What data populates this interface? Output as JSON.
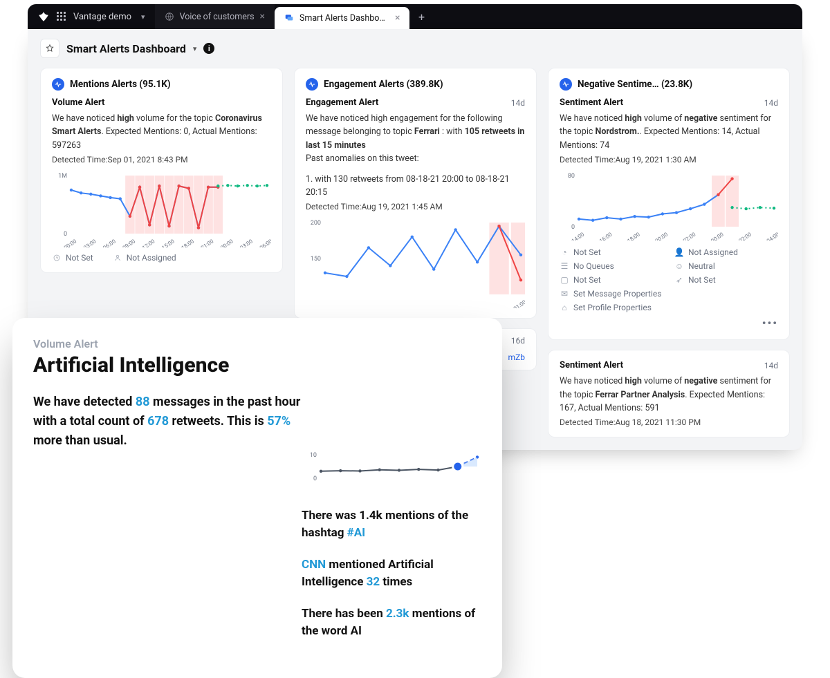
{
  "topbar": {
    "workspace": "Vantage demo",
    "tabs": [
      {
        "label": "Voice of customers",
        "active": false
      },
      {
        "label": "Smart Alerts Dashboard",
        "active": true
      }
    ]
  },
  "page": {
    "title": "Smart Alerts Dashboard"
  },
  "columns": {
    "mentions": {
      "header": "Mentions Alerts  (95.1K)",
      "alert": {
        "title": "Volume Alert",
        "text_pre": "We have noticed ",
        "text_bold1": "high",
        "text_mid": " volume for the topic ",
        "text_bold2": "Coronavirus Smart Alerts",
        "text_post": ". Expected Mentions: 0, Actual Mentions: 597263",
        "detected": "Detected Time:Sep 01, 2021 8:43 PM"
      },
      "meta": {
        "notset": "Not Set",
        "notassigned": "Not Assigned"
      }
    },
    "engagement": {
      "header": "Engagement Alerts  (389.8K)",
      "alert": {
        "title": "Engagement Alert",
        "age": "14d",
        "line1": "We have noticed high engagement for the following message belonging to topic ",
        "bold1": "Ferrari",
        "line2": " :  with ",
        "bold2": "105 retweets in last 15 minutes",
        "line3": "Past anomalies on this tweet:",
        "line4": "1.  with 130 retweets from 08-18-21 20:00 to 08-18-21 20:15",
        "detected": "Detected Time:Aug 19, 2021 1:45 AM"
      },
      "second": {
        "age": "16d",
        "link": "mZb"
      }
    },
    "sentiment": {
      "header": "Negative Sentime…   (23.8K)",
      "alert": {
        "title": "Sentiment Alert",
        "age": "14d",
        "pre": "We have noticed ",
        "b1": "high",
        "mid1": " volume of ",
        "b2": "negative",
        "mid2": " sentiment for the topic ",
        "b3": "Nordstrom.",
        "post": ". Expected Mentions: 14, Actual Mentions: 74",
        "detected": "Detected Time:Aug 19, 2021 1:30 AM"
      },
      "meta": {
        "notset": "Not Set",
        "notassigned": "Not Assigned",
        "noqueues": "No Queues",
        "neutral": "Neutral",
        "notset2": "Not Set",
        "notset3": "Not Set",
        "setmsg": "Set Message Properties",
        "setprof": "Set Profile Properties"
      },
      "alert2": {
        "title": "Sentiment Alert",
        "age": "14d",
        "pre": "We have noticed ",
        "b1": "high",
        "mid1": " volume of ",
        "b2": "negative",
        "mid2": " sentiment for the topic ",
        "b3": "Ferrar Partner Analysis",
        "post": ". Expected Mentions: 167, Actual Mentions: 591",
        "detected": "Detected Time:Aug 18, 2021 11:30 PM"
      }
    }
  },
  "overlay": {
    "kicker": "Volume Alert",
    "title": "Artificial Intelligence",
    "body": {
      "p1": "We have detected ",
      "n1": "88",
      "p2": " messages in the past hour with a total count of ",
      "n2": "678",
      "p3": " retweets. This is ",
      "n3": "57%",
      "p4": " more than usual."
    },
    "right": {
      "l1a": "There was 1.4k mentions of the hashtag ",
      "l1tag": "#AI",
      "l2a": "CNN",
      "l2b": " mentioned Artificial Intelligence ",
      "l2n": "32",
      "l2c": " times",
      "l3a": "There has been ",
      "l3n": "2.3k",
      "l3b": " mentions of the word AI"
    }
  },
  "chart_data": [
    {
      "id": "mentions-chart",
      "type": "line",
      "title": "",
      "xlabel": "",
      "ylabel": "",
      "categories": [
        "00:00",
        "03:00",
        "06:00",
        "09:00",
        "12:00",
        "15:00",
        "18:00",
        "21:00",
        "00:00",
        "03:00",
        "06:00"
      ],
      "ylim": [
        0,
        1000000
      ],
      "yticks": [
        0,
        1000000
      ],
      "yticklabels": [
        "0",
        "1M"
      ],
      "series": [
        {
          "name": "actual",
          "color": "#3b82f6",
          "values": [
            750000,
            700000,
            680000,
            650000,
            620000,
            600000,
            300000,
            800000,
            150000,
            820000,
            130000,
            820000,
            780000,
            100000,
            800000,
            800000,
            null,
            null,
            null,
            null,
            null
          ]
        },
        {
          "name": "anomaly",
          "color": "#ef4444",
          "values": [
            null,
            null,
            null,
            null,
            null,
            null,
            300000,
            800000,
            150000,
            820000,
            130000,
            820000,
            780000,
            100000,
            800000,
            800000,
            null,
            null,
            null,
            null,
            null
          ]
        },
        {
          "name": "forecast",
          "color": "#10b981",
          "style": "dotted",
          "values": [
            null,
            null,
            null,
            null,
            null,
            null,
            null,
            null,
            null,
            null,
            null,
            null,
            null,
            null,
            null,
            820000,
            830000,
            820000,
            830000,
            820000,
            830000
          ]
        }
      ]
    },
    {
      "id": "engagement-chart",
      "type": "line",
      "title": "",
      "ylim": [
        100,
        200
      ],
      "yticks": [
        150,
        200
      ],
      "yticklabels": [
        "150",
        "200"
      ],
      "categories": [
        "",
        "",
        "",
        "",
        "",
        "",
        "",
        "",
        "",
        "01:00"
      ],
      "series": [
        {
          "name": "actual",
          "color": "#3b82f6",
          "values": [
            130,
            125,
            165,
            140,
            180,
            135,
            190,
            145,
            195,
            155
          ]
        },
        {
          "name": "anomaly",
          "color": "#ef4444",
          "values": [
            null,
            null,
            null,
            null,
            null,
            null,
            null,
            null,
            195,
            120
          ]
        }
      ]
    },
    {
      "id": "sentiment-chart",
      "type": "line",
      "title": "",
      "ylim": [
        0,
        80
      ],
      "yticks": [
        0,
        80
      ],
      "yticklabels": [
        "0",
        "80"
      ],
      "categories": [
        "14:00",
        "16:00",
        "18:00",
        "20:00",
        "22:00",
        "00:00",
        "02:00",
        "04:00"
      ],
      "series": [
        {
          "name": "actual",
          "color": "#3b82f6",
          "values": [
            12,
            10,
            14,
            12,
            16,
            15,
            20,
            22,
            28,
            35,
            50,
            null,
            null,
            null,
            null
          ]
        },
        {
          "name": "anomaly",
          "color": "#ef4444",
          "values": [
            null,
            null,
            null,
            null,
            null,
            null,
            null,
            null,
            null,
            null,
            50,
            75,
            null,
            null,
            null
          ]
        },
        {
          "name": "forecast",
          "color": "#10b981",
          "style": "dotted",
          "values": [
            null,
            null,
            null,
            null,
            null,
            null,
            null,
            null,
            null,
            null,
            null,
            30,
            28,
            30,
            29
          ]
        }
      ]
    },
    {
      "id": "overlay-chart",
      "type": "line",
      "title": "",
      "ylim": [
        0,
        10
      ],
      "categories": [
        "",
        "",
        "",
        "",
        "",
        "",
        "",
        "",
        ""
      ],
      "series": [
        {
          "name": "actual",
          "color": "#4b5563",
          "values": [
            3,
            3.2,
            3.1,
            3.6,
            3.4,
            3.8,
            3.5,
            5,
            null
          ]
        },
        {
          "name": "forecast",
          "color": "#2563eb",
          "style": "dashed",
          "values": [
            null,
            null,
            null,
            null,
            null,
            null,
            null,
            5,
            9
          ]
        }
      ]
    }
  ]
}
